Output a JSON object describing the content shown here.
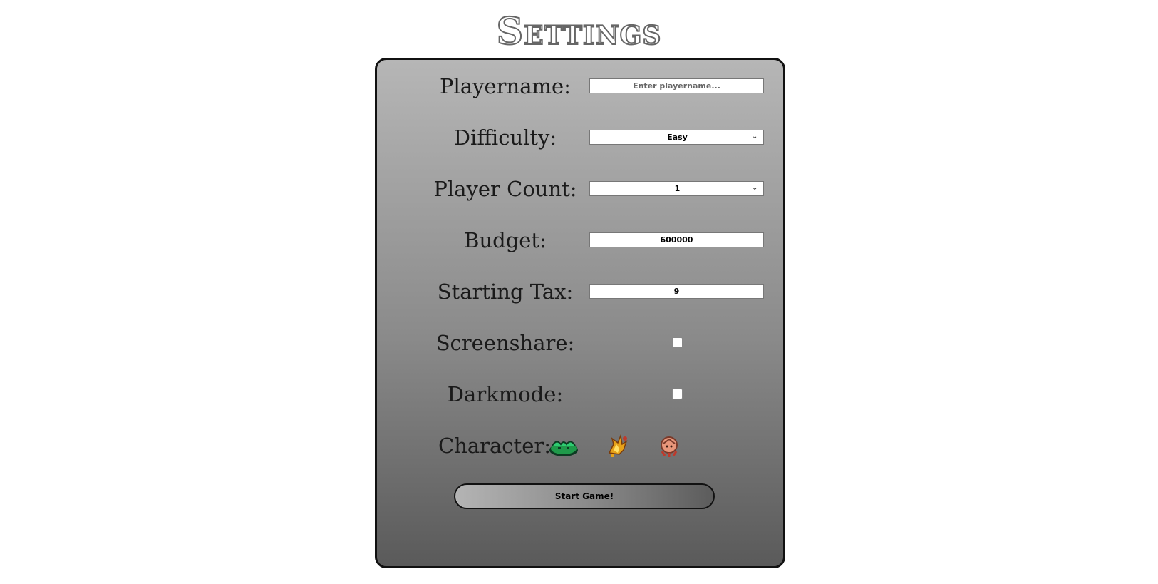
{
  "page": {
    "title": "Settings"
  },
  "form": {
    "playername": {
      "label": "Playername:",
      "value": "",
      "placeholder": "Enter playername..."
    },
    "difficulty": {
      "label": "Difficulty:",
      "selected": "Easy"
    },
    "player_count": {
      "label": "Player Count:",
      "selected": "1"
    },
    "budget": {
      "label": "Budget:",
      "value": "600000"
    },
    "starting_tax": {
      "label": "Starting Tax:",
      "value": "9"
    },
    "screenshare": {
      "label": "Screenshare:",
      "checked": false
    },
    "darkmode": {
      "label": "Darkmode:",
      "checked": false
    },
    "character": {
      "label": "Character:",
      "options": [
        {
          "icon": "green-slime-character-icon"
        },
        {
          "icon": "fire-character-icon"
        },
        {
          "icon": "shell-creature-character-icon"
        }
      ]
    },
    "start_button": {
      "label": "Start Game!"
    }
  },
  "colors": {
    "panel_gradient_top": "#b6b6b6",
    "panel_gradient_bottom": "#5a5a5a",
    "border": "#111111"
  }
}
